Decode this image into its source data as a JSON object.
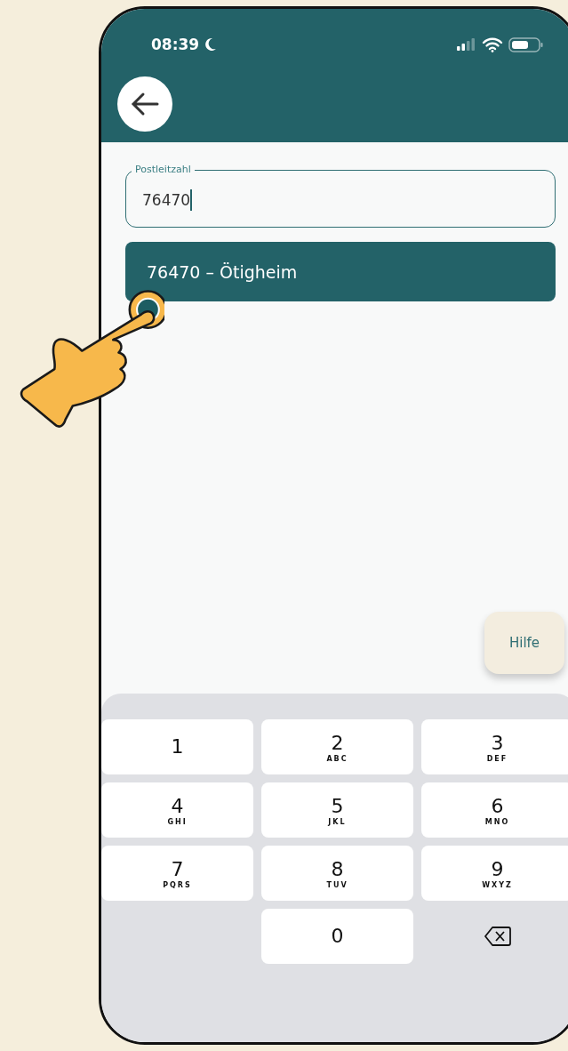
{
  "status_bar": {
    "time": "08:39"
  },
  "field": {
    "label": "Postleitzahl",
    "value": "76470"
  },
  "suggestions": [
    {
      "text": "76470 – Ötigheim",
      "selected": true
    }
  ],
  "help_button": {
    "label": "Hilfe"
  },
  "keypad": {
    "keys": [
      {
        "kind": "digit",
        "digit": "1"
      },
      {
        "kind": "digit",
        "digit": "2",
        "letters": "ABC"
      },
      {
        "kind": "digit",
        "digit": "3",
        "letters": "DEF"
      },
      {
        "kind": "digit",
        "digit": "4",
        "letters": "GHI"
      },
      {
        "kind": "digit",
        "digit": "5",
        "letters": "JKL"
      },
      {
        "kind": "digit",
        "digit": "6",
        "letters": "MNO"
      },
      {
        "kind": "digit",
        "digit": "7",
        "letters": "PQRS"
      },
      {
        "kind": "digit",
        "digit": "8",
        "letters": "TUV"
      },
      {
        "kind": "digit",
        "digit": "9",
        "letters": "WXYZ"
      },
      {
        "kind": "blank"
      },
      {
        "kind": "digit",
        "digit": "0"
      },
      {
        "kind": "delete"
      }
    ]
  }
}
